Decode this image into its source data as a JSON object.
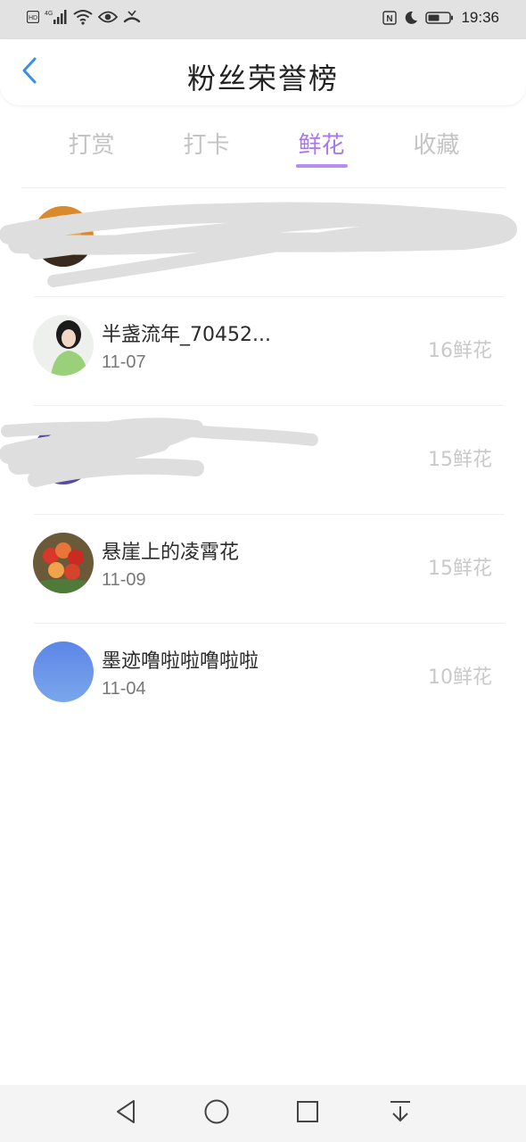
{
  "status_bar": {
    "time": "19:36",
    "icons": [
      "hd-icon",
      "signal-4g-icon",
      "wifi-icon",
      "eye-icon",
      "missed-call-icon",
      "nfc-icon",
      "moon-icon",
      "battery-icon"
    ]
  },
  "header": {
    "title": "粉丝荣誉榜",
    "back_icon": "chevron-left-icon"
  },
  "tabs": [
    {
      "label": "打赏",
      "active": false
    },
    {
      "label": "打卡",
      "active": false
    },
    {
      "label": "鲜花",
      "active": true
    },
    {
      "label": "收藏",
      "active": false
    }
  ],
  "list": [
    {
      "name": "",
      "date": "",
      "flowers": "",
      "redacted": true
    },
    {
      "name": "半盏流年_70452...",
      "date": "11-07",
      "flowers": "16鲜花",
      "redacted": false
    },
    {
      "name": "",
      "date": "",
      "flowers": "15鲜花",
      "redacted": true
    },
    {
      "name": "悬崖上的凌霄花",
      "date": "11-09",
      "flowers": "15鲜花",
      "redacted": false
    },
    {
      "name": "墨迹噜啦啦噜啦啦",
      "date": "11-04",
      "flowers": "10鲜花",
      "redacted": false
    }
  ],
  "nav_bar": {
    "buttons": [
      "back-triangle-icon",
      "home-circle-icon",
      "recents-square-icon",
      "notification-down-icon"
    ]
  },
  "colors": {
    "accent": "#a877e8",
    "back_arrow": "#3a8ee6",
    "status_bar_bg": "#e2e2e2"
  }
}
